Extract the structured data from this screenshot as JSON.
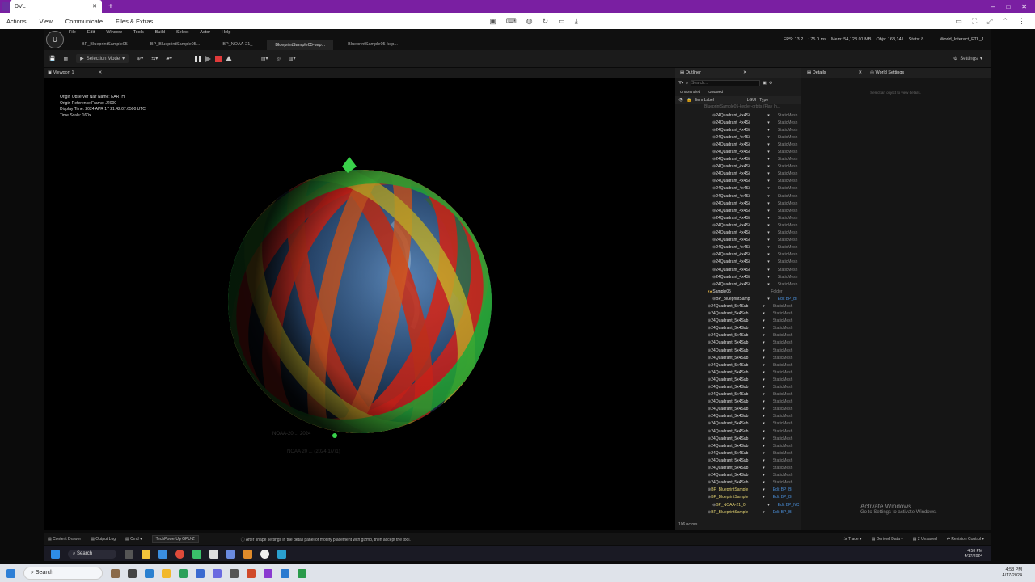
{
  "remote": {
    "tab_title": "DVL",
    "menu": [
      "Actions",
      "View",
      "Communicate",
      "Files & Extras"
    ],
    "window_controls": [
      "–",
      "□",
      "✕"
    ]
  },
  "ue": {
    "logo": "U",
    "menu": [
      "File",
      "Edit",
      "Window",
      "Tools",
      "Build",
      "Select",
      "Actor",
      "Help"
    ],
    "doc_tabs": [
      "BP_BlueprintSample05",
      "BP_BlueprintSample05...",
      "BP_NOAA-21_",
      "BlueprintSample05-kep...",
      "BlueprintSample05-kep..."
    ],
    "stats": {
      "fps": "FPS: 13.2",
      "ms": ": 75.0 ms",
      "mem": "Mem: 54,123.01 MB",
      "objs": "Objs: 163,141",
      "stats_label": "Stats: 8",
      "level": "World_Interact_FTL_1"
    },
    "toolbar": {
      "mode": "Selection Mode",
      "settings": "Settings"
    },
    "viewport_tab": "Viewport 1",
    "overlay_lines": [
      "Origin Observer Naif Name: EARTH",
      "Origin Reference Frame: J2000",
      "Display Time: 2024 APR 17 21:42:07.6500 UTC",
      "Time Scale: 160x"
    ],
    "ghost_text": [
      "NOAA-20 ... 2024",
      "NOAA 20 ... (2024 1/7/1)"
    ]
  },
  "outliner": {
    "tab": "Outliner",
    "search_placeholder": "Search...",
    "filters": [
      "Uncontrolled",
      "Unsaved"
    ],
    "col_label": "Item Label",
    "col_lgui": "LGUI",
    "col_type": "Type",
    "top_item": "BlueprintSample05-kepler-orbits (Play In...",
    "quad4_name": "24Quadrant_4x4Si",
    "quad5_name": "24Quadrant_5x4Sub",
    "type_static": "StaticMesh",
    "folder": "Sample05",
    "folder_type": "Folder",
    "bp_sample": "BP_BlueprintSamp",
    "bp_sample2": "BP_BlueprintSample",
    "bp_noaa": "BP_NOAA-21_0",
    "edit_bp": "Edit BP_Bl",
    "edit_noaa": "Edit BP_NC",
    "actor_count": "106 actors"
  },
  "details": {
    "tab": "Details",
    "world_tab": "World Settings",
    "hint": "Select an object to view details."
  },
  "statusbar": {
    "content_drawer": "Content Drawer",
    "output_log": "Output Log",
    "cmd": "Cmd",
    "tooltip": "TechPowerUp GPU-Z",
    "message": "After shape settings in the detail panel or modify placement with gizmo, then accept the tool.",
    "trace": "Trace",
    "derived": "Derived Data",
    "unsaved": "2 Unsaved",
    "revision": "Revision Control"
  },
  "watermark": {
    "title": "Activate Windows",
    "sub": "Go to Settings to activate Windows."
  },
  "inner_taskbar": {
    "search": "Search",
    "time": "4:58 PM",
    "date": "4/17/2024"
  },
  "taskbar": {
    "search": "Search",
    "time": "4:58 PM",
    "date": "4/17/2024"
  }
}
